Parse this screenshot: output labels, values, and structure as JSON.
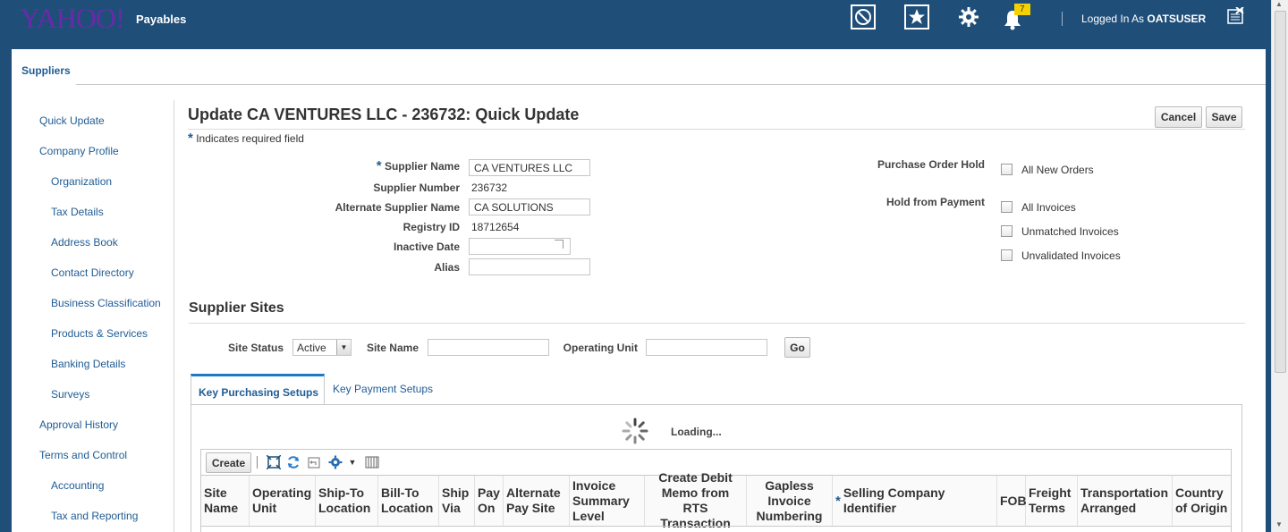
{
  "header": {
    "logo": "YAHOO!",
    "app_name": "Payables",
    "notification_count": "7",
    "logged_in_prefix": "Logged In As",
    "username": "OATSUSER",
    "icons": [
      "accessibility-icon",
      "favorites-icon",
      "settings-icon",
      "notifications-icon",
      "close-icon"
    ]
  },
  "tabs": {
    "suppliers": "Suppliers"
  },
  "nav": {
    "items": [
      "Quick Update",
      "Company Profile",
      "Organization",
      "Tax Details",
      "Address Book",
      "Contact Directory",
      "Business Classification",
      "Products & Services",
      "Banking Details",
      "Surveys",
      "Approval History",
      "Terms and Control",
      "Accounting",
      "Tax and Reporting"
    ]
  },
  "page": {
    "title": "Update CA VENTURES LLC - 236732: Quick Update",
    "cancel_label": "Cancel",
    "save_label": "Save",
    "required_star": "*",
    "required_note": "Indicates required field"
  },
  "form": {
    "supplier_name_label": "Supplier Name",
    "supplier_name_value": "CA VENTURES LLC",
    "supplier_number_label": "Supplier Number",
    "supplier_number_value": "236732",
    "alt_name_label": "Alternate Supplier Name",
    "alt_name_value": "CA SOLUTIONS",
    "registry_label": "Registry ID",
    "registry_value": "18712654",
    "inactive_label": "Inactive Date",
    "inactive_value": "",
    "alias_label": "Alias",
    "alias_value": "",
    "po_hold_label": "Purchase Order Hold",
    "po_hold_option": "All New Orders",
    "hold_payment_label": "Hold from Payment",
    "hold_options": [
      "All Invoices",
      "Unmatched Invoices",
      "Unvalidated Invoices"
    ]
  },
  "sites": {
    "title": "Supplier Sites",
    "status_label": "Site Status",
    "status_value": "Active",
    "site_name_label": "Site Name",
    "site_name_value": "",
    "op_unit_label": "Operating Unit",
    "op_unit_value": "",
    "go_label": "Go",
    "tab_active": "Key Purchasing Setups",
    "tab_inactive": "Key Payment Setups",
    "loading": "Loading...",
    "create_label": "Create",
    "columns": [
      "Site Name",
      "Operating Unit",
      "Ship-To Location",
      "Bill-To Location",
      "Ship Via",
      "Pay On",
      "Alternate Pay Site",
      "Invoice Summary Level",
      "Create Debit Memo from RTS Transaction",
      "Gapless Invoice Numbering",
      "Selling Company Identifier",
      "FOB",
      "Freight Terms",
      "Transportation Arranged",
      "Country of Origin"
    ],
    "selling_company_required": "*"
  },
  "colors": {
    "header_bg": "#1f4e79",
    "link": "#1f5c94",
    "badge": "#f5d100",
    "logo": "#6a2aa8"
  }
}
